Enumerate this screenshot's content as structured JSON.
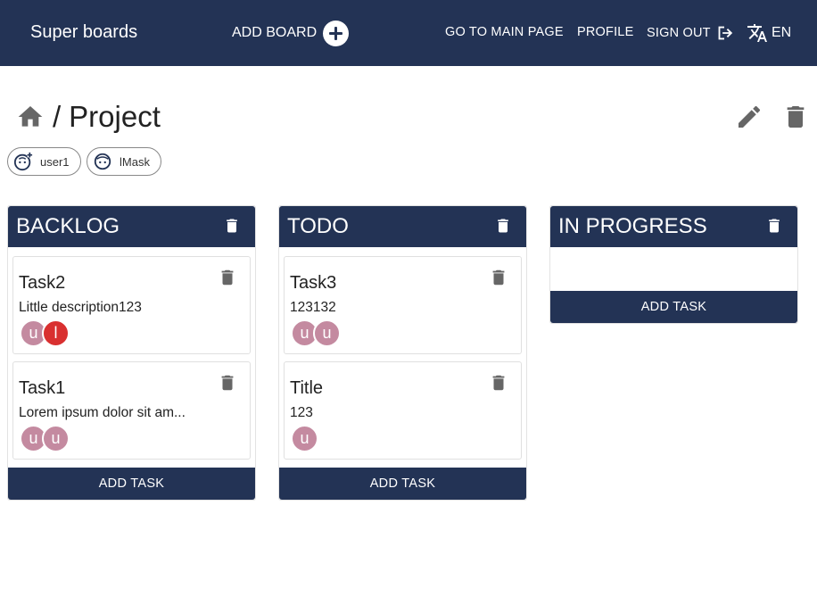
{
  "header": {
    "logo": "Super boards",
    "add_board": "ADD BOARD",
    "nav_main": "GO TO MAIN PAGE",
    "nav_profile": "PROFILE",
    "nav_signout": "SIGN OUT",
    "lang": "EN",
    "bg_color": "#233355"
  },
  "breadcrumb": {
    "separator": "/",
    "title": "Project"
  },
  "users": [
    {
      "name": "user1",
      "icon": "face-add-icon"
    },
    {
      "name": "lMask",
      "icon": "face-icon"
    }
  ],
  "columns": [
    {
      "title": "BACKLOG",
      "add_task": "ADD TASK",
      "tasks": [
        {
          "title": "Task2",
          "desc": "Little description123",
          "avatars": [
            {
              "letter": "u",
              "color": "#c48aa0"
            },
            {
              "letter": "l",
              "color": "#d93030"
            }
          ]
        },
        {
          "title": "Task1",
          "desc": "Lorem ipsum dolor sit am...",
          "avatars": [
            {
              "letter": "u",
              "color": "#c48aa0"
            },
            {
              "letter": "u",
              "color": "#c48aa0"
            }
          ]
        }
      ]
    },
    {
      "title": "TODO",
      "add_task": "ADD TASK",
      "tasks": [
        {
          "title": "Task3",
          "desc": "123132",
          "avatars": [
            {
              "letter": "u",
              "color": "#c48aa0"
            },
            {
              "letter": "u",
              "color": "#c48aa0"
            }
          ]
        },
        {
          "title": "Title",
          "desc": "123",
          "avatars": [
            {
              "letter": "u",
              "color": "#c48aa0"
            }
          ]
        }
      ]
    },
    {
      "title": "IN PROGRESS",
      "add_task": "ADD TASK",
      "tasks": []
    }
  ]
}
